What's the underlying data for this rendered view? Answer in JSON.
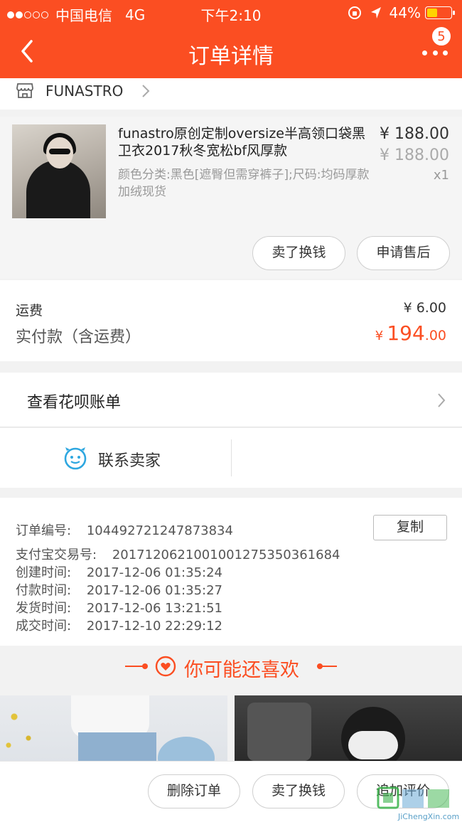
{
  "status_bar": {
    "carrier": "中国电信",
    "network": "4G",
    "time": "下午2:10",
    "battery": "44%",
    "battery_level": 0.44
  },
  "navbar": {
    "title": "订单详情",
    "badge": "5"
  },
  "shop": {
    "name": "FUNASTRO"
  },
  "product": {
    "name": "funastro原创定制oversize半高领口袋黑卫衣2017秋冬宽松bf风厚款",
    "sku": "颜色分类:黑色[遮臀但需穿裤子];尺码:均码厚款加绒现货",
    "price": "¥ 188.00",
    "original_price": "¥ 188.00",
    "quantity": "x1",
    "resell_button": "卖了换钱",
    "aftersale_button": "申请售后"
  },
  "fees": {
    "shipping_label": "运费",
    "shipping_value": "¥ 6.00",
    "total_label": "实付款（含运费）",
    "total_currency": "¥",
    "total_integer": "194",
    "total_decimal": ".00"
  },
  "huabei": {
    "label": "查看花呗账单"
  },
  "contact": {
    "label": "联系卖家"
  },
  "order_info": {
    "order_no_label": "订单编号:",
    "order_no": "104492721247873834",
    "copy_button": "复制",
    "alipay_label": "支付宝交易号:",
    "alipay_no": "2017120621001001275350361684",
    "created_label": "创建时间:",
    "created": "2017-12-06 01:35:24",
    "paid_label": "付款时间:",
    "paid": "2017-12-06 01:35:27",
    "shipped_label": "发货时间:",
    "shipped": "2017-12-06 13:21:51",
    "completed_label": "成交时间:",
    "completed": "2017-12-10 22:29:12"
  },
  "recommend": {
    "title": "你可能还喜欢"
  },
  "bottom_bar": {
    "delete_button": "删除订单",
    "resell_button": "卖了换钱",
    "review_button": "追加评价"
  },
  "watermark": {
    "url": "JiChengXin.com"
  },
  "colors": {
    "brand": "#fb4e22",
    "price_highlight": "#fb4e22",
    "contact_icon": "#2ea7e0"
  },
  "icons": [
    "back-icon",
    "more-icon",
    "shop-icon",
    "chevron-right-icon",
    "contact-smile-icon",
    "heart-icon"
  ]
}
